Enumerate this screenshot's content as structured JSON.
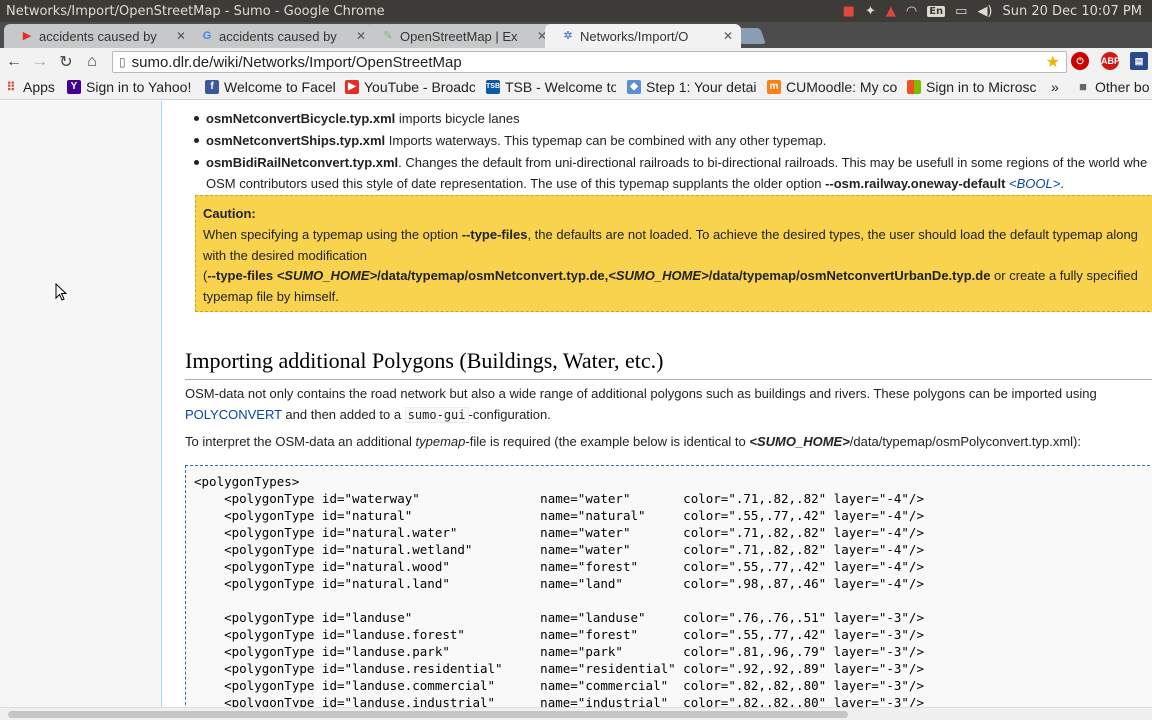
{
  "os": {
    "window_title": "Networks/Import/OpenStreetMap - Sumo - Google Chrome",
    "keyboard": "En",
    "clock": "Sun 20 Dec 10:07 PM"
  },
  "tabs": [
    {
      "label": "accidents caused by",
      "icon": "youtube-icon"
    },
    {
      "label": "accidents caused by",
      "icon": "google-icon"
    },
    {
      "label": "OpenStreetMap | Ex",
      "icon": "osm-icon"
    },
    {
      "label": "Networks/Import/O",
      "icon": "sumo-icon",
      "active": true
    }
  ],
  "toolbar": {
    "url": "sumo.dlr.de/wiki/Networks/Import/OpenStreetMap"
  },
  "extensions": [
    "ABP"
  ],
  "bookmarks": {
    "apps": "Apps",
    "items": [
      {
        "label": "Sign in to Yahoo!",
        "icon": "yahoo-icon",
        "color": "#400090"
      },
      {
        "label": "Welcome to Facel",
        "icon": "facebook-icon",
        "color": "#3b5998"
      },
      {
        "label": "YouTube - Broadc",
        "icon": "youtube-icon",
        "color": "#e52d27"
      },
      {
        "label": "TSB - Welcome to",
        "icon": "tsb-icon",
        "color": "#0a5aa8"
      },
      {
        "label": "Step 1: Your detai",
        "icon": "step-icon",
        "color": "#5a8fd0"
      },
      {
        "label": "CUMoodle: My co",
        "icon": "moodle-icon",
        "color": "#f98012"
      },
      {
        "label": "Sign in to Microsc",
        "icon": "microsoft-icon",
        "color": "#f25022"
      }
    ],
    "more": "»",
    "other": "Other bo"
  },
  "content": {
    "b1_name": "osmNetconvertBicycle.typ.xml",
    "b1_text": " imports bicycle lanes",
    "b2_name": "osmNetconvertShips.typ.xml",
    "b2_text": " Imports waterways. This typemap can be combined with any other typemap.",
    "b3_name": "osmBidiRailNetconvert.typ.xml",
    "b3_text": ". Changes the default from uni-directional railroads to bi-directional railroads. This may be usefull in some regions of the world whe",
    "b3_line2_a": "OSM contributors used this style of date representation. The use of this typemap supplants the older option ",
    "b3_line2_opt": "--osm.railway.oneway-default",
    "b3_line2_bool": " <BOOL>",
    "b3_line2_end": ".",
    "caution_title": "Caution:",
    "caution_l1_a": "When specifying a typemap using the option ",
    "caution_l1_opt": "--type-files",
    "caution_l1_b": ", the defaults are not loaded. To achieve the desired types, the user should load the default typemap along",
    "caution_l2": "with the desired modification",
    "caution_l3_a": "(",
    "caution_l3_b": "--type-files ",
    "caution_l3_c": "<SUMO_HOME>",
    "caution_l3_d": "/data/typemap/osmNetconvert.typ.de,",
    "caution_l3_e": "<SUMO_HOME>",
    "caution_l3_f": "/data/typemap/osmNetconvertUrbanDe.typ.de",
    "caution_l3_g": " or create a fully specified",
    "caution_l4": "typemap file by himself.",
    "heading": "Importing additional Polygons (Buildings, Water, etc.)",
    "p1_a": "OSM-data not only contains the road network but also a wide range of additional polygons such as buildings and rivers. These polygons can be imported using",
    "p1_link": "POLYCONVERT",
    "p1_b": " and then added to a ",
    "p1_code": "sumo-gui",
    "p1_c": "-configuration.",
    "p2_a": "To interpret the OSM-data an additional ",
    "p2_em": "typemap",
    "p2_b": "-file is required (the example below is identical to ",
    "p2_home": "<SUMO_HOME>",
    "p2_c": "/data/typemap/osmPolyconvert.typ.xml):",
    "code_lines": [
      "<polygonTypes>",
      "    <polygonType id=\"waterway\"                name=\"water\"       color=\".71,.82,.82\" layer=\"-4\"/>",
      "    <polygonType id=\"natural\"                 name=\"natural\"     color=\".55,.77,.42\" layer=\"-4\"/>",
      "    <polygonType id=\"natural.water\"           name=\"water\"       color=\".71,.82,.82\" layer=\"-4\"/>",
      "    <polygonType id=\"natural.wetland\"         name=\"water\"       color=\".71,.82,.82\" layer=\"-4\"/>",
      "    <polygonType id=\"natural.wood\"            name=\"forest\"      color=\".55,.77,.42\" layer=\"-4\"/>",
      "    <polygonType id=\"natural.land\"            name=\"land\"        color=\".98,.87,.46\" layer=\"-4\"/>",
      "",
      "    <polygonType id=\"landuse\"                 name=\"landuse\"     color=\".76,.76,.51\" layer=\"-3\"/>",
      "    <polygonType id=\"landuse.forest\"          name=\"forest\"      color=\".55,.77,.42\" layer=\"-3\"/>",
      "    <polygonType id=\"landuse.park\"            name=\"park\"        color=\".81,.96,.79\" layer=\"-3\"/>",
      "    <polygonType id=\"landuse.residential\"     name=\"residential\" color=\".92,.92,.89\" layer=\"-3\"/>",
      "    <polygonType id=\"landuse.commercial\"      name=\"commercial\"  color=\".82,.82,.80\" layer=\"-3\"/>",
      "    <polygonType id=\"landuse.industrial\"      name=\"industrial\"  color=\".82,.82,.80\" layer=\"-3\"/>"
    ]
  }
}
